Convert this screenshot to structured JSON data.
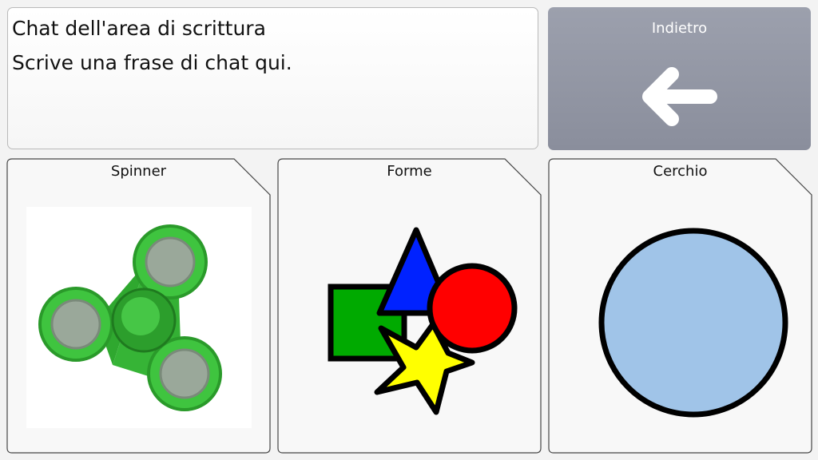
{
  "message_area": {
    "lines": [
      "Chat dell'area di scrittura",
      "Scrive una frase di chat qui."
    ]
  },
  "back_button": {
    "label": "Indietro",
    "icon": "arrow-left-icon"
  },
  "cards": [
    {
      "label": "Spinner",
      "icon": "fidget-spinner-image"
    },
    {
      "label": "Forme",
      "icon": "shapes-image"
    },
    {
      "label": "Cerchio",
      "icon": "circle-image"
    }
  ],
  "colors": {
    "back_button": "#9399a7",
    "spinner_green": "#3bbb3b",
    "square": "#00aa00",
    "triangle": "#0022ff",
    "circle_red": "#ff0000",
    "star": "#ffff00",
    "circle_blue": "#a0c4e8"
  }
}
